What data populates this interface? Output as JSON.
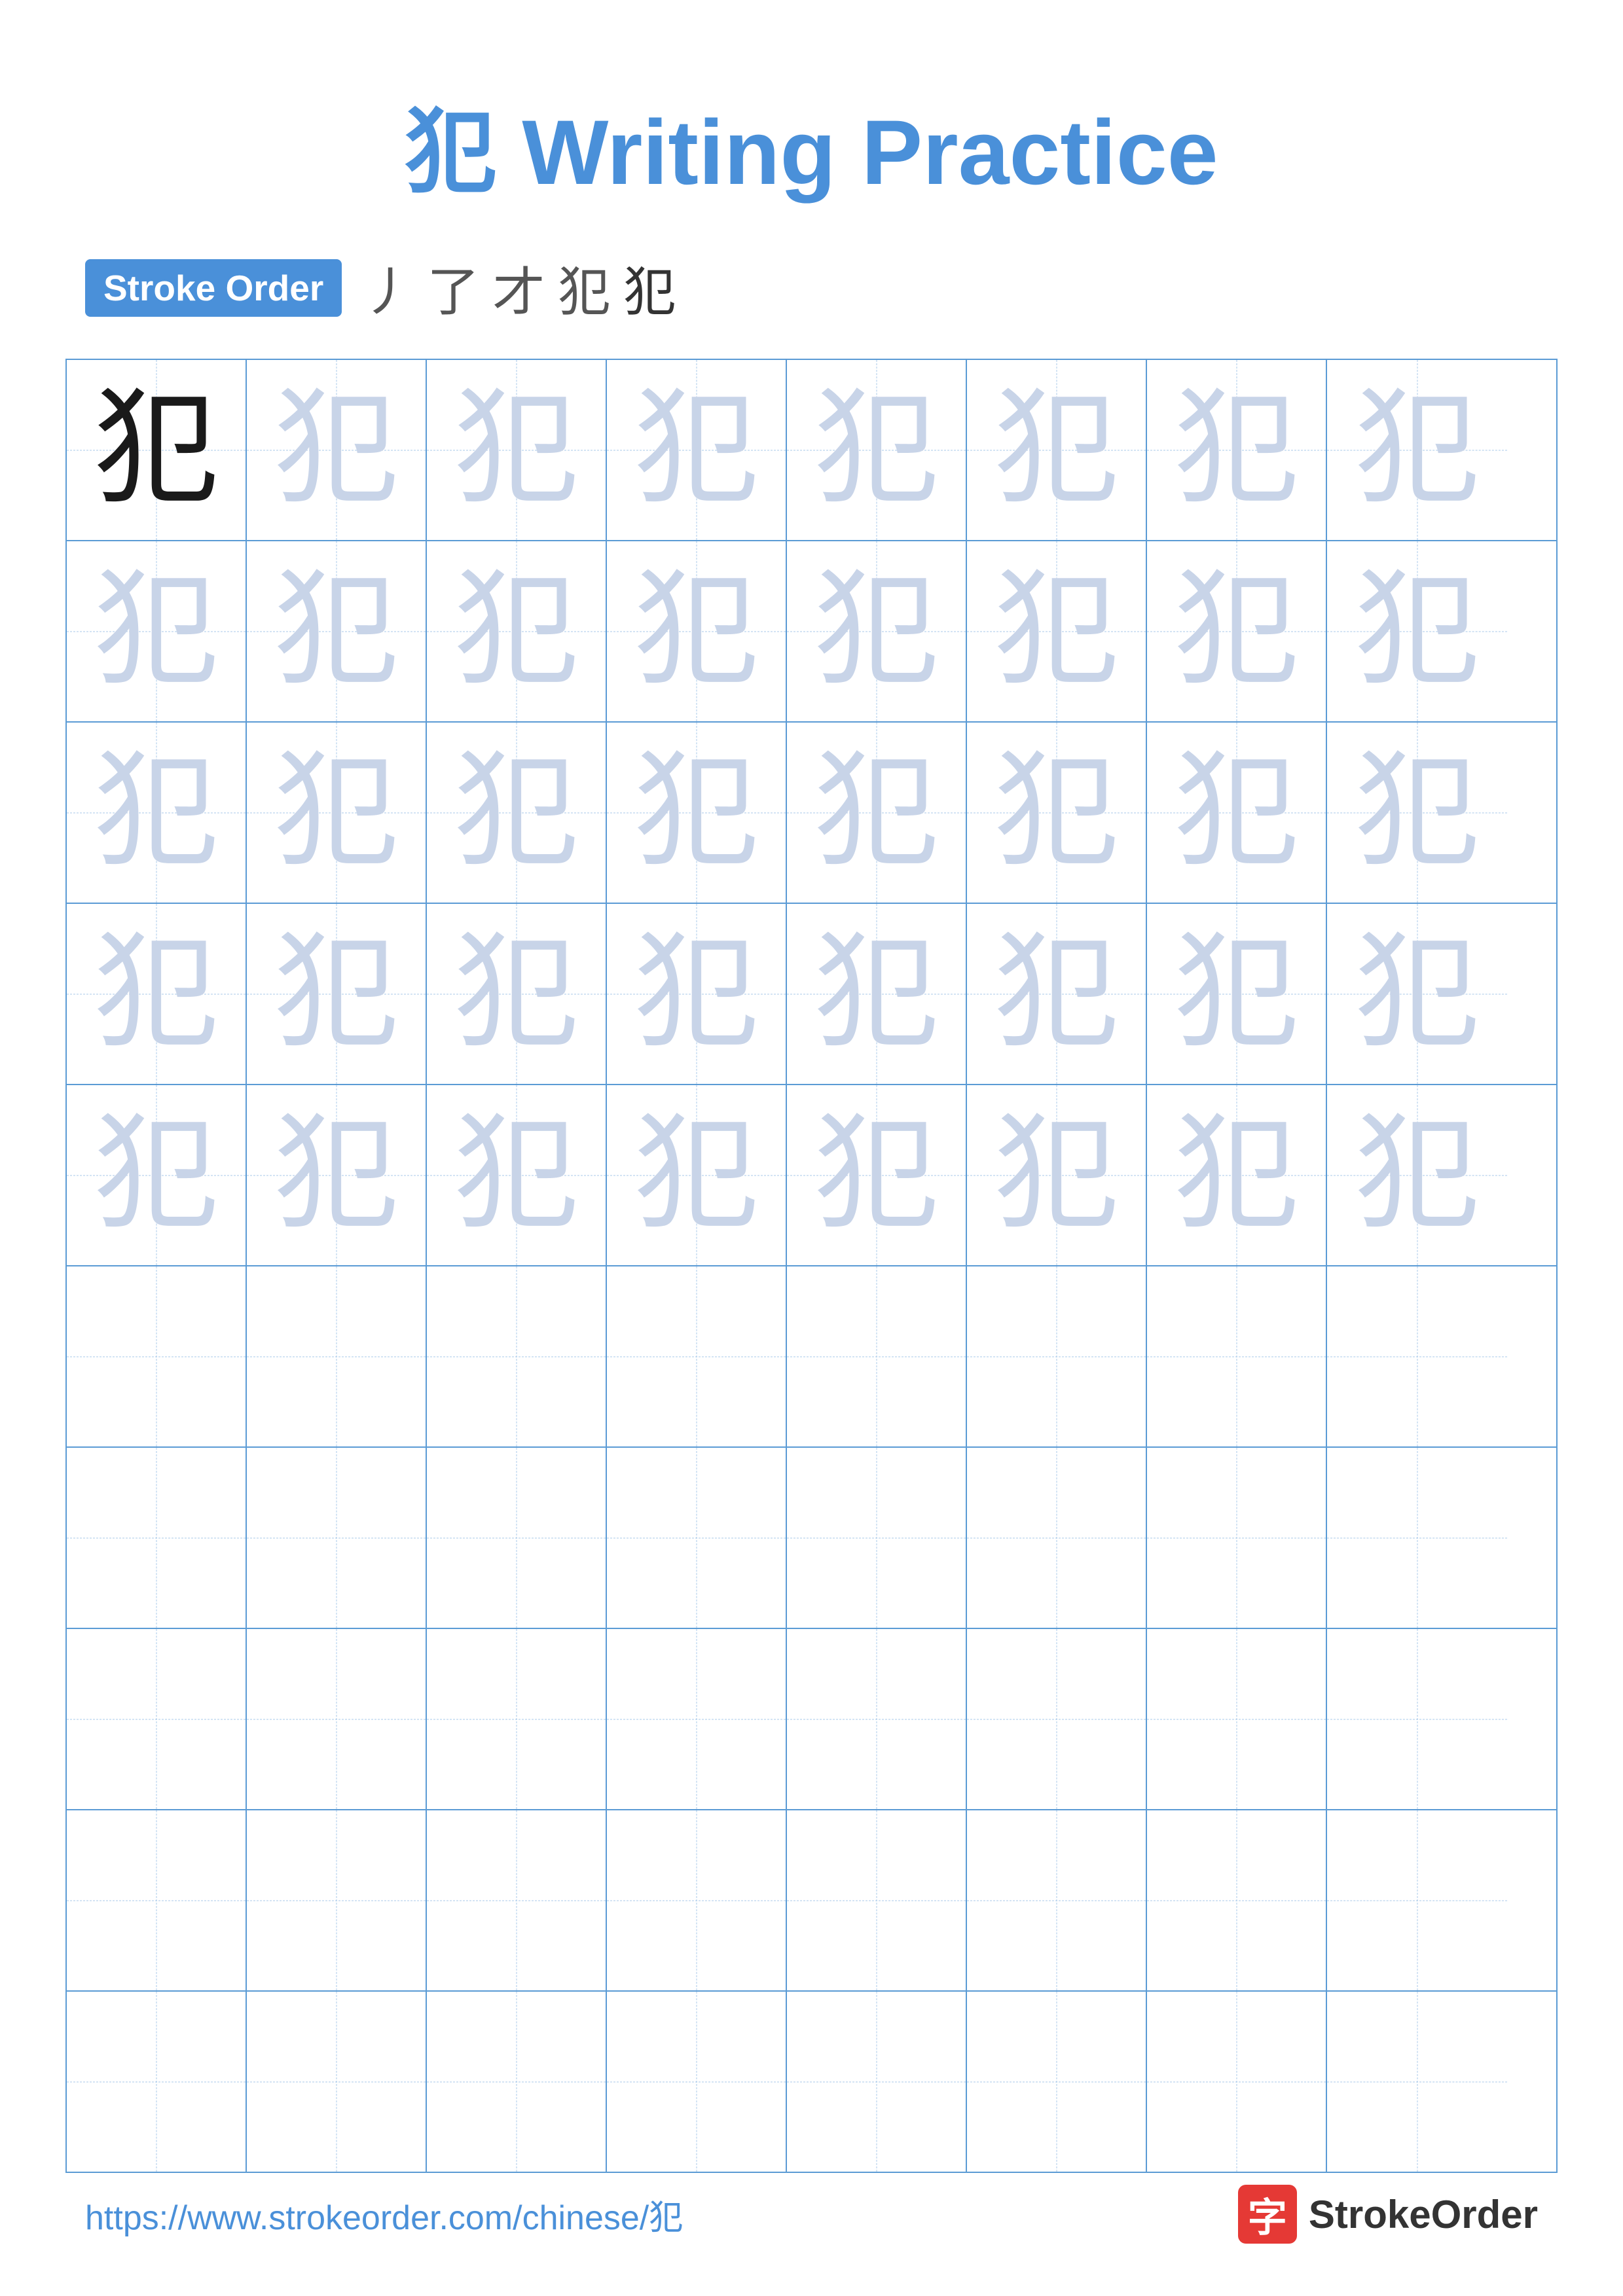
{
  "page": {
    "title": "犯 Writing Practice",
    "title_char": "犯",
    "title_text": " Writing Practice"
  },
  "stroke_order": {
    "badge_label": "Stroke Order",
    "strokes": [
      "丿",
      "了",
      "才",
      "犯",
      "犯"
    ]
  },
  "grid": {
    "rows": 10,
    "cols": 8,
    "char": "犯",
    "practice_rows": 5,
    "empty_rows": 5
  },
  "footer": {
    "url": "https://www.strokeorder.com/chinese/犯",
    "logo_char": "字",
    "logo_name": "StrokeOrder"
  },
  "colors": {
    "blue_accent": "#4A90D9",
    "char_dark": "#1a1a1a",
    "char_light": "#D0D8E8",
    "border_blue": "#5B9BD5",
    "dashed_blue": "#A8C8E8"
  }
}
